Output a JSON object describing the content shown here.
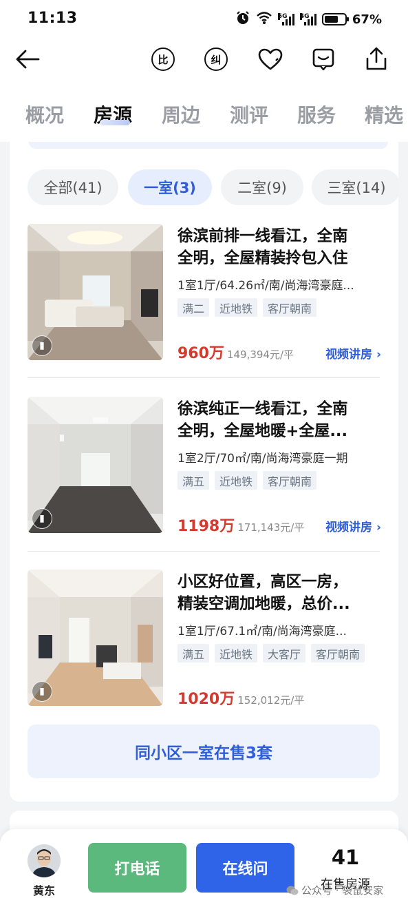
{
  "status": {
    "time": "11:13",
    "net1": "5G",
    "net2": "4G",
    "battery_text": "67%",
    "battery_level": 0.67
  },
  "nav": {
    "back_icon": "back-arrow-icon",
    "compare_char": "比",
    "correct_char": "纠",
    "icons": [
      "favorite-heart-icon",
      "note-icon",
      "share-icon"
    ]
  },
  "tabs": [
    {
      "label": "概况"
    },
    {
      "label": "房源"
    },
    {
      "label": "周边"
    },
    {
      "label": "测评"
    },
    {
      "label": "服务"
    },
    {
      "label": "精选"
    }
  ],
  "active_tab": 1,
  "filters": [
    {
      "label": "全部(41)"
    },
    {
      "label": "一室(3)"
    },
    {
      "label": "二室(9)"
    },
    {
      "label": "三室(14)"
    }
  ],
  "active_filter": 1,
  "listings": [
    {
      "title_line1": "徐滨前排一线看江，全南",
      "title_line2": "全明，全屋精装拎包入住",
      "meta": "1室1厅/64.26㎡/南/尚海湾豪庭...",
      "tags": [
        "满二",
        "近地铁",
        "客厅朝南"
      ],
      "price": "960万",
      "unit_price": "149,394元/平",
      "video_link": "视频讲房 ›"
    },
    {
      "title_line1": "徐滨纯正一线看江，全南",
      "title_line2": "全明，全屋地暖+全屋...",
      "meta": "1室2厅/70㎡/南/尚海湾豪庭一期",
      "tags": [
        "满五",
        "近地铁",
        "客厅朝南"
      ],
      "price": "1198万",
      "unit_price": "171,143元/平",
      "video_link": "视频讲房 ›"
    },
    {
      "title_line1": "小区好位置，高区一房，",
      "title_line2": "精装空调加地暖，总价...",
      "meta": "1室1厅/67.1㎡/南/尚海湾豪庭...",
      "tags": [
        "满五",
        "近地铁",
        "大客厅",
        "客厅朝南"
      ],
      "price": "1020万",
      "unit_price": "152,012元/平",
      "video_link": ""
    }
  ],
  "same_community_button": "同小区一室在售3套",
  "bottom": {
    "agent_name": "黄东",
    "call_label": "打电话",
    "chat_label": "在线问",
    "listing_count": "41",
    "listing_count_label": "在售房源",
    "watermark": "公众号 · 袋鼠安家"
  },
  "colors": {
    "accent_blue": "#2f5ed8",
    "price_red": "#d63a2f",
    "call_green": "#5cb97e",
    "chat_blue": "#2f63e8"
  }
}
